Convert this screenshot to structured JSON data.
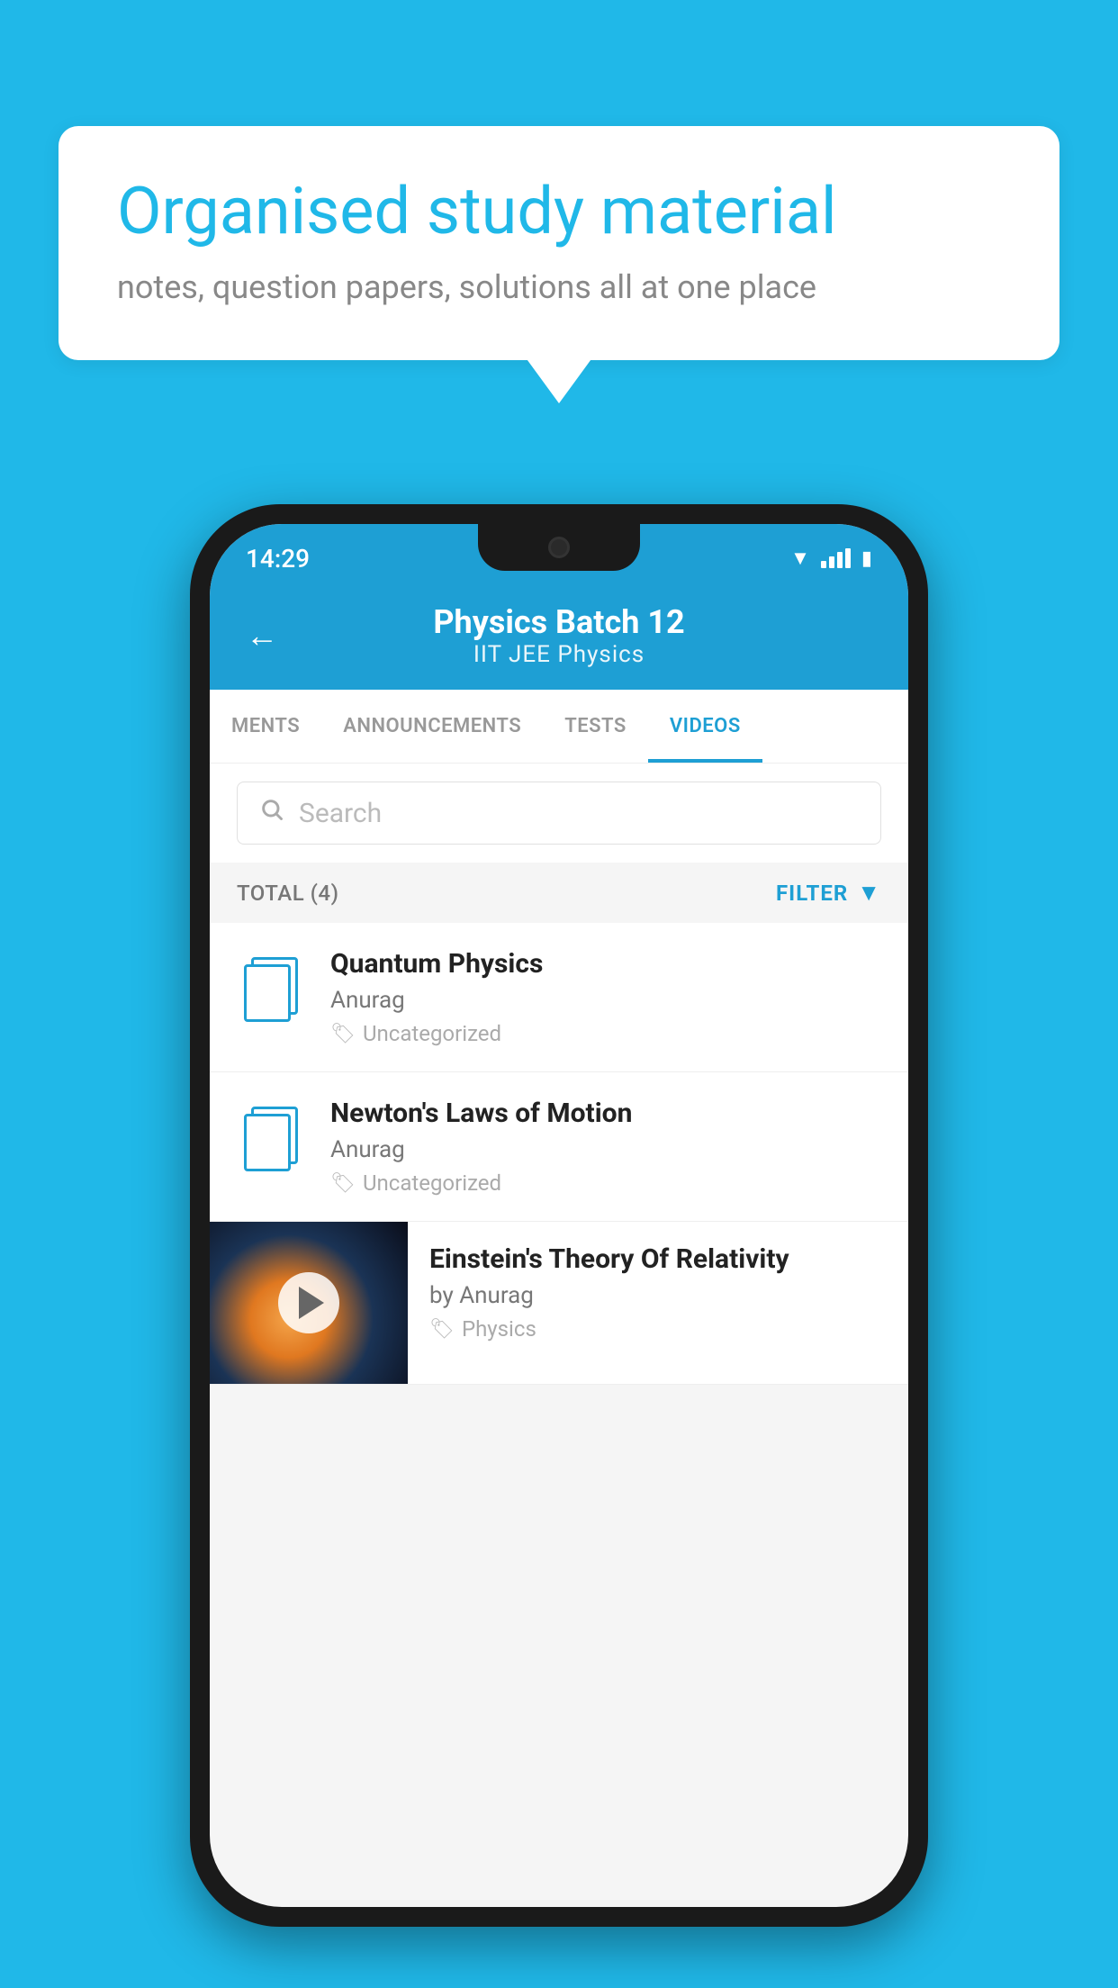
{
  "background_color": "#20b8e8",
  "speech_bubble": {
    "title": "Organised study material",
    "subtitle": "notes, question papers, solutions all at one place"
  },
  "phone": {
    "status_bar": {
      "time": "14:29"
    },
    "header": {
      "back_label": "←",
      "title": "Physics Batch 12",
      "subtitle": "IIT JEE   Physics"
    },
    "tabs": [
      {
        "label": "MENTS",
        "active": false
      },
      {
        "label": "ANNOUNCEMENTS",
        "active": false
      },
      {
        "label": "TESTS",
        "active": false
      },
      {
        "label": "VIDEOS",
        "active": true
      }
    ],
    "search": {
      "placeholder": "Search"
    },
    "filter_bar": {
      "total_label": "TOTAL (4)",
      "filter_label": "FILTER"
    },
    "videos": [
      {
        "id": 1,
        "title": "Quantum Physics",
        "author": "Anurag",
        "tag": "Uncategorized",
        "type": "document"
      },
      {
        "id": 2,
        "title": "Newton's Laws of Motion",
        "author": "Anurag",
        "tag": "Uncategorized",
        "type": "document"
      },
      {
        "id": 3,
        "title": "Einstein's Theory Of Relativity",
        "author": "by Anurag",
        "tag": "Physics",
        "type": "video"
      }
    ]
  }
}
